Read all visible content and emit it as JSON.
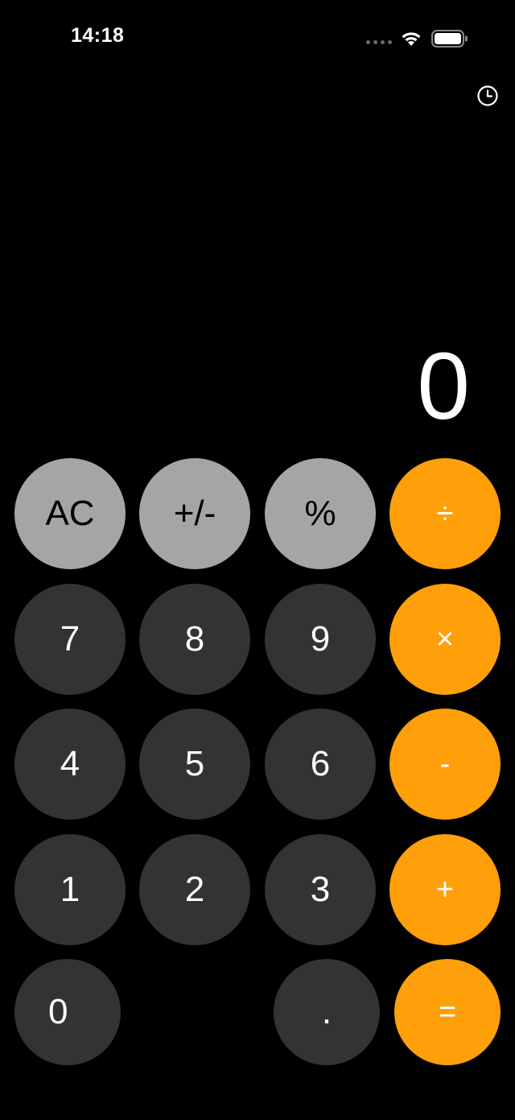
{
  "status_bar": {
    "time": "14:18"
  },
  "display": {
    "value": "0"
  },
  "keys": {
    "row1": [
      "AC",
      "+/-",
      "%",
      "÷"
    ],
    "row2": [
      "7",
      "8",
      "9",
      "×"
    ],
    "row3": [
      "4",
      "5",
      "6",
      "-"
    ],
    "row4": [
      "1",
      "2",
      "3",
      "+"
    ],
    "row5": [
      "0",
      ".",
      "="
    ]
  },
  "colors": {
    "background": "#000000",
    "function_key": "#a5a5a5",
    "number_key": "#333333",
    "operator_key": "#ff9f0a"
  },
  "icons": {
    "history": "clock-icon",
    "wifi": "wifi-icon",
    "battery": "battery-icon",
    "signal": "cellular-signal-icon"
  }
}
